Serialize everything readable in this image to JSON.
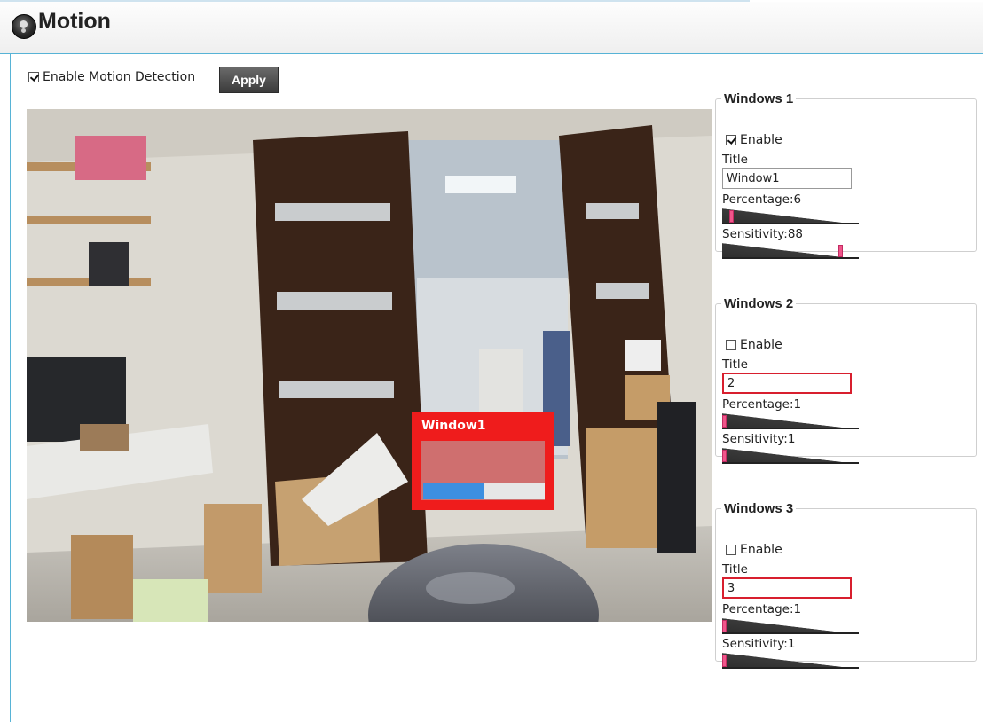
{
  "header": {
    "title": "Motion",
    "logo_icon": "camera-logo-icon"
  },
  "controls": {
    "enable_motion_label": "Enable Motion Detection",
    "enable_motion_checked": true,
    "apply_label": "Apply"
  },
  "preview": {
    "motion_window": {
      "title": "Window1",
      "level_fraction": 0.5,
      "border_color": "#ef1c1c",
      "bar_color": "#3d8fe0"
    }
  },
  "windows": [
    {
      "legend": "Windows 1",
      "enable_label": "Enable",
      "enabled": true,
      "title_label": "Title",
      "title_value": "Window1",
      "percentage_label": "Percentage:6",
      "percentage": 6,
      "sensitivity_label": "Sensitivity:88",
      "sensitivity": 88,
      "title_error": false
    },
    {
      "legend": "Windows 2",
      "enable_label": "Enable",
      "enabled": false,
      "title_label": "Title",
      "title_value": "2",
      "percentage_label": "Percentage:1",
      "percentage": 1,
      "sensitivity_label": "Sensitivity:1",
      "sensitivity": 1,
      "title_error": true
    },
    {
      "legend": "Windows 3",
      "enable_label": "Enable",
      "enabled": false,
      "title_label": "Title",
      "title_value": "3",
      "percentage_label": "Percentage:1",
      "percentage": 1,
      "sensitivity_label": "Sensitivity:1",
      "sensitivity": 1,
      "title_error": true
    }
  ],
  "colors": {
    "accent_border": "#57b3d6",
    "error_border": "#d81f2e",
    "slider_knob": "#f0558a"
  }
}
